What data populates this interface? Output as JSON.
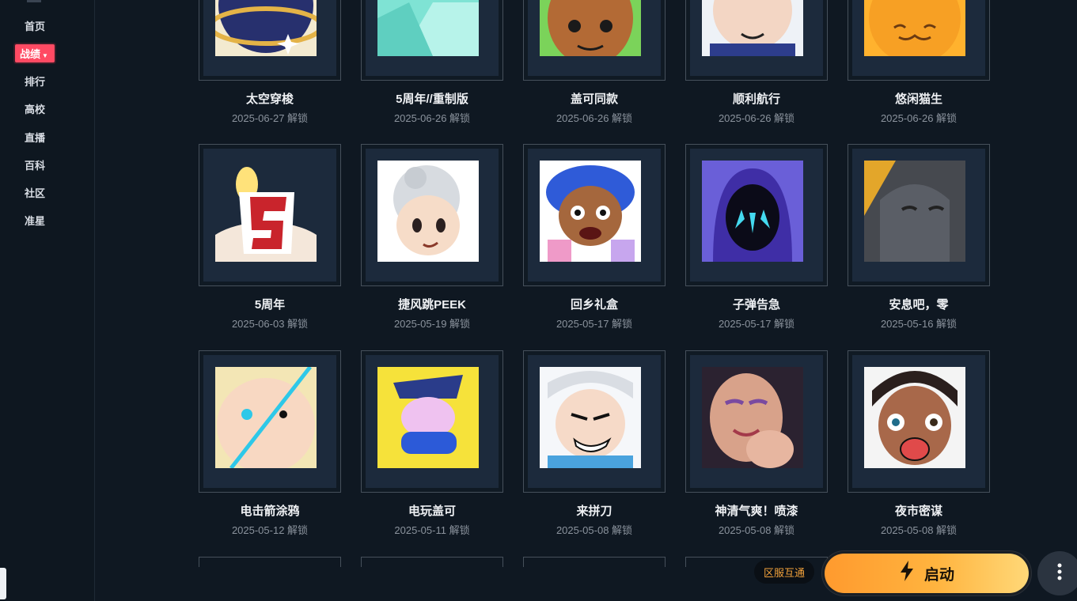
{
  "sidebar": {
    "items": [
      {
        "label": "首页"
      },
      {
        "label": "战绩",
        "active": true
      },
      {
        "label": "排行"
      },
      {
        "label": "高校"
      },
      {
        "label": "直播"
      },
      {
        "label": "百科"
      },
      {
        "label": "社区"
      },
      {
        "label": "准星"
      }
    ],
    "active_color": "#ff4a63"
  },
  "cards": [
    {
      "title": "太空穿梭",
      "date": "2025-06-27 解锁",
      "icon": "space-shuttle-art"
    },
    {
      "title": "5周年//重制版",
      "date": "2025-06-26 解锁",
      "icon": "crystal-art"
    },
    {
      "title": "盖可同款",
      "date": "2025-06-26 解锁",
      "icon": "gekko-face-art"
    },
    {
      "title": "顺利航行",
      "date": "2025-06-26 解锁",
      "icon": "smooth-sailing-art"
    },
    {
      "title": "悠闲猫生",
      "date": "2025-06-26 解锁",
      "icon": "cat-art"
    },
    {
      "title": "5周年",
      "date": "2025-06-03 解锁",
      "icon": "birthday-candle-art"
    },
    {
      "title": "捷风跳PEEK",
      "date": "2025-05-19 解锁",
      "icon": "jett-peek-art"
    },
    {
      "title": "回乡礼盒",
      "date": "2025-05-17 解锁",
      "icon": "gift-box-art"
    },
    {
      "title": "子弹告急",
      "date": "2025-05-17 解锁",
      "icon": "hooded-agent-art"
    },
    {
      "title": "安息吧，零",
      "date": "2025-05-16 解锁",
      "icon": "robot-art"
    },
    {
      "title": "电击箭涂鸦",
      "date": "2025-05-12 解锁",
      "icon": "shock-dart-art"
    },
    {
      "title": "电玩盖可",
      "date": "2025-05-11 解锁",
      "icon": "gamer-gekko-art"
    },
    {
      "title": "来拼刀",
      "date": "2025-05-08 解锁",
      "icon": "knife-fight-art"
    },
    {
      "title": "神清气爽！喷漆",
      "date": "2025-05-08 解锁",
      "icon": "refreshed-art"
    },
    {
      "title": "夜市密谋",
      "date": "2025-05-08 解锁",
      "icon": "night-market-art"
    }
  ],
  "footer": {
    "region_label": "区服互通",
    "launch_label": "启动",
    "launch_icon": "lightning-icon",
    "more_icon": "more-vertical-icon"
  }
}
